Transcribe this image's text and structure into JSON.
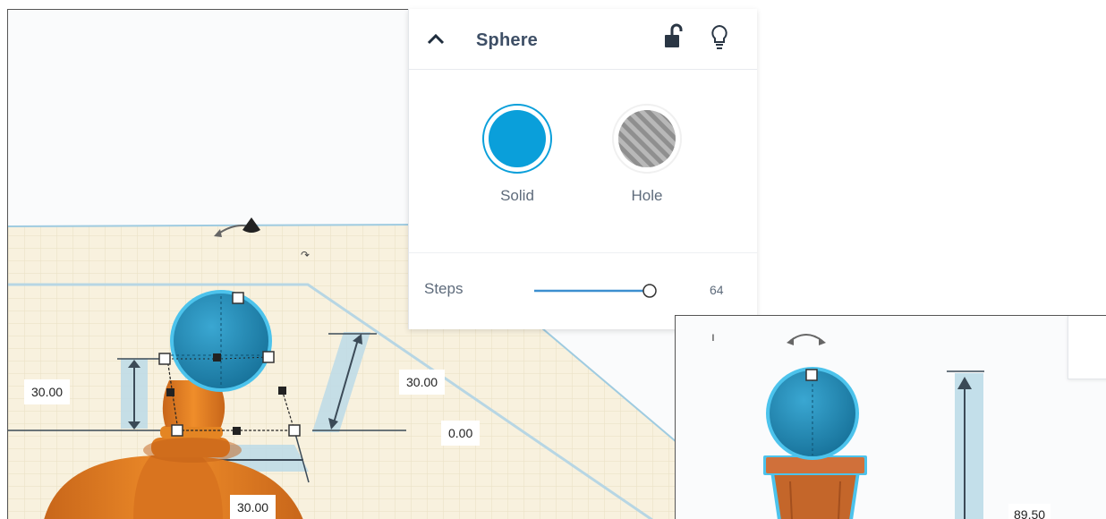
{
  "panel": {
    "title": "Sphere",
    "options": [
      {
        "label": "Solid",
        "color": "#0a9fda",
        "selected": true
      },
      {
        "label": "Hole",
        "color": "#9a9a9a",
        "selected": false
      }
    ],
    "steps": {
      "label": "Steps",
      "value": "64",
      "level": 1.0
    },
    "icons": [
      "chevron-up-icon",
      "unlock-icon",
      "lightbulb-icon"
    ]
  },
  "dimensions": {
    "left_height": "30.00",
    "right_height": "30.00",
    "elevation": "0.00",
    "width": "30.00"
  },
  "inset": {
    "height": "89.50"
  },
  "colors": {
    "accent": "#0a9fda",
    "sphere": "#1f8fbd",
    "pawn": "#e8821e",
    "grid": "#f7efd9",
    "workplane_border": "#9fcbe0"
  }
}
